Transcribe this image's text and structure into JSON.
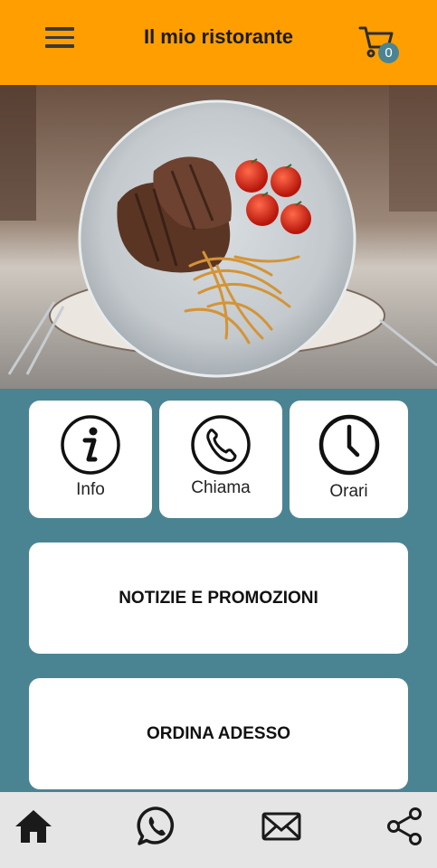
{
  "header": {
    "title": "Il mio ristorante",
    "cart_count": "0",
    "menu_icon": "hamburger-menu-icon",
    "cart_icon": "shopping-cart-icon"
  },
  "hero": {
    "image": "plate-of-grilled-steak-with-fries-and-tomatoes"
  },
  "tiles": [
    {
      "label": "Info",
      "icon": "info-icon"
    },
    {
      "label": "Chiama",
      "icon": "phone-icon"
    },
    {
      "label": "Orari",
      "icon": "clock-icon"
    }
  ],
  "buttons": {
    "news": "NOTIZIE E PROMOZIONI",
    "order": "ORDINA ADESSO"
  },
  "bottom_nav": [
    {
      "icon": "home-icon"
    },
    {
      "icon": "whatsapp-icon"
    },
    {
      "icon": "mail-icon"
    },
    {
      "icon": "share-icon"
    }
  ],
  "colors": {
    "header": "#ff9e00",
    "background": "#4a8493",
    "bottom_bar": "#e5e5e5",
    "badge": "#4a8493"
  }
}
